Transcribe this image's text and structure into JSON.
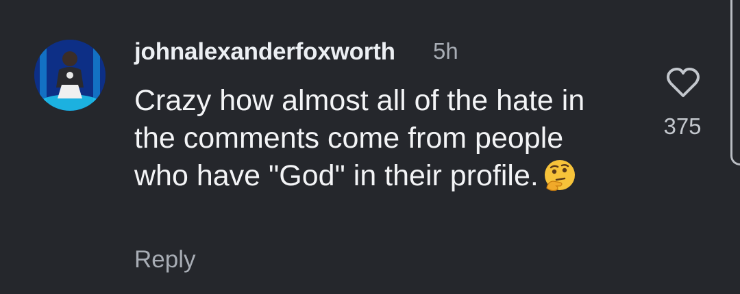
{
  "comment": {
    "username": "johnalexanderfoxworth",
    "timestamp": "5h",
    "text": "Crazy how almost all of the hate in the comments come from people who have \"God\" in their profile.",
    "emoji": "thinking-face",
    "reply_label": "Reply",
    "like_count": "375",
    "like_icon": "heart-outline-icon"
  },
  "colors": {
    "background": "#25272c",
    "primary_text": "#f3f4f6",
    "secondary_text": "#a8adb5"
  }
}
